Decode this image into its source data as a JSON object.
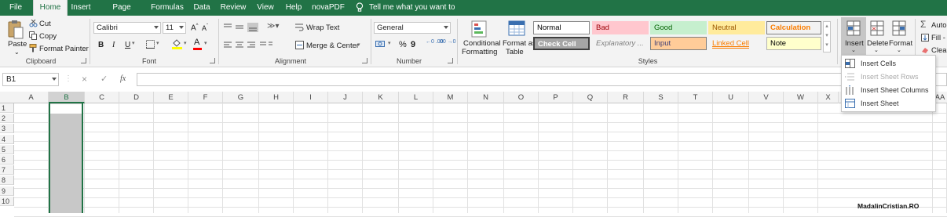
{
  "tabs": [
    "File",
    "Home",
    "Insert",
    "Page Layout",
    "Formulas",
    "Data",
    "Review",
    "View",
    "Help",
    "novaPDF"
  ],
  "tellme": "Tell me what you want to do",
  "clipboard": {
    "paste": "Paste",
    "cut": "Cut",
    "copy": "Copy",
    "format_painter": "Format Painter",
    "label": "Clipboard"
  },
  "font": {
    "name": "Calibri",
    "size": "11",
    "label": "Font",
    "bold": "B",
    "italic": "I",
    "underline": "U",
    "grow": "A",
    "shrink": "A"
  },
  "alignment": {
    "wrap": "Wrap Text",
    "merge": "Merge & Center",
    "label": "Alignment"
  },
  "number": {
    "format": "General",
    "percent": "%",
    "comma": "9",
    "inc_dec": "←0 .00",
    "dec_dec": ".00 →0",
    "label": "Number"
  },
  "styles": {
    "conditional": [
      "Conditional",
      "Formatting"
    ],
    "format_table": [
      "Format as",
      "Table"
    ],
    "cells": [
      {
        "label": "Normal",
        "bg": "#ffffff",
        "color": "#000000",
        "border": "#8a8a8a"
      },
      {
        "label": "Bad",
        "bg": "#ffc7ce",
        "color": "#9c0006",
        "border": "#ffc7ce"
      },
      {
        "label": "Good",
        "bg": "#c6efce",
        "color": "#006100",
        "border": "#c6efce"
      },
      {
        "label": "Neutral",
        "bg": "#ffeb9c",
        "color": "#9c5700",
        "border": "#ffeb9c"
      },
      {
        "label": "Calculation",
        "bg": "#f2f2f2",
        "color": "#fa7d00",
        "border": "#7f7f7f"
      },
      {
        "label": "Check Cell",
        "bg": "#a5a5a5",
        "color": "#ffffff",
        "border": "#3f3f3f"
      },
      {
        "label": "Explanatory ...",
        "bg": "#f3f3f3",
        "color": "#7f7f7f",
        "border": "#f3f3f3"
      },
      {
        "label": "Input",
        "bg": "#ffcc99",
        "color": "#3f3f76",
        "border": "#7f7f7f"
      },
      {
        "label": "Linked Cell",
        "bg": "#f3f3f3",
        "color": "#fa7d00",
        "border": "#f3f3f3"
      },
      {
        "label": "Note",
        "bg": "#ffffcc",
        "color": "#000000",
        "border": "#b2b2b2"
      }
    ],
    "label": "Styles"
  },
  "cells_group": {
    "insert": "Insert",
    "delete": "Delete",
    "format": "Format"
  },
  "editing": {
    "autosum": "Auto",
    "fill": "Fill -",
    "clear": "Clear"
  },
  "formula_bar": {
    "name_box": "B1",
    "fx": "fx",
    "cancel": "×",
    "enter": "✓"
  },
  "columns": [
    "A",
    "B",
    "C",
    "D",
    "E",
    "F",
    "G",
    "H",
    "I",
    "J",
    "K",
    "L",
    "M",
    "N",
    "O",
    "P",
    "Q",
    "R",
    "S",
    "T",
    "U",
    "V",
    "W",
    "X",
    "AA"
  ],
  "rows": [
    "1",
    "2",
    "3",
    "4",
    "5",
    "6",
    "7",
    "8",
    "9",
    "10"
  ],
  "insert_menu": [
    {
      "label": "Insert Cells",
      "enabled": true
    },
    {
      "label": "Insert Sheet Rows",
      "enabled": false
    },
    {
      "label": "Insert Sheet Columns",
      "enabled": true
    },
    {
      "label": "Insert Sheet",
      "enabled": true
    }
  ],
  "watermark": "MadalinCristian.RO",
  "colors": {
    "brand": "#217346",
    "ribbon": "#f3f3f3"
  }
}
